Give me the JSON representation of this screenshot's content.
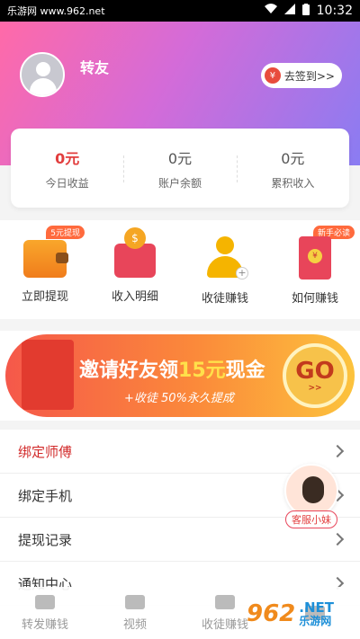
{
  "status_bar": {
    "watermark": "乐游网 www.962.net",
    "time": "10:32"
  },
  "profile": {
    "username": "转友",
    "checkin_label": "去签到>>",
    "checkin_coin": "¥"
  },
  "stats": [
    {
      "value": "0元",
      "label": "今日收益"
    },
    {
      "value": "0元",
      "label": "账户余额"
    },
    {
      "value": "0元",
      "label": "累积收入"
    }
  ],
  "actions": [
    {
      "label": "立即提现",
      "tag": "5元提现",
      "icon": "wallet-icon"
    },
    {
      "label": "收入明细",
      "tag": "",
      "icon": "purse-icon",
      "coin": "$"
    },
    {
      "label": "收徒赚钱",
      "tag": "",
      "icon": "person-add-icon"
    },
    {
      "label": "如何赚钱",
      "tag": "新手必读",
      "icon": "red-envelope-icon"
    }
  ],
  "banner": {
    "title_a": "邀请好友领",
    "title_b": "15元",
    "title_c": "现金",
    "subtitle": "+收徒 50%永久提成",
    "go": "GO",
    "go_sub": ">>"
  },
  "menu": [
    {
      "label": "绑定师傅",
      "highlight": true
    },
    {
      "label": "绑定手机"
    },
    {
      "label": "提现记录"
    },
    {
      "label": "通知中心"
    }
  ],
  "service": {
    "label": "客服小妹"
  },
  "tabs": [
    {
      "label": "转发赚钱"
    },
    {
      "label": "视频"
    },
    {
      "label": "收徒赚钱"
    }
  ],
  "corner_watermark": {
    "number": "962",
    "line1": ".NET",
    "line2": "乐游网"
  },
  "colors": {
    "header_start": "#ff6aa8",
    "header_end": "#8a7cf2",
    "accent_red": "#e23d3d",
    "banner_orange": "#fb8a3a"
  }
}
